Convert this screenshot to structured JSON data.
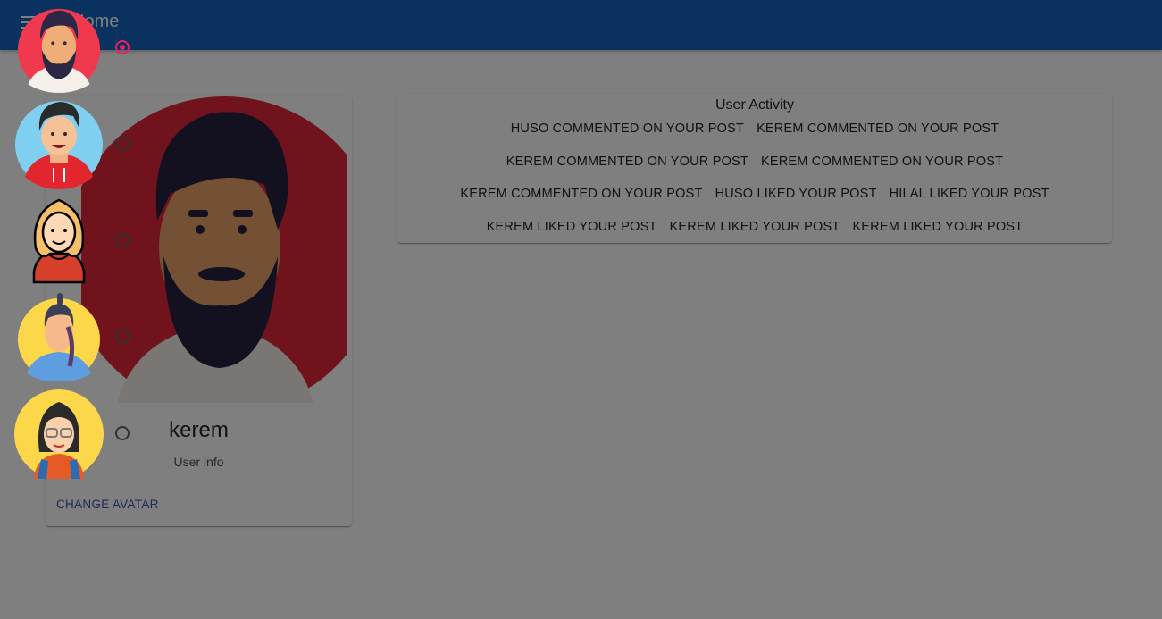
{
  "appbar": {
    "title": "Home",
    "color": "#1565c0"
  },
  "profile": {
    "username": "kerem",
    "subtitle": "User info",
    "change_avatar_label": "CHANGE AVATAR"
  },
  "activity": {
    "title": "User Activity",
    "rows": [
      [
        "HUSO COMMENTED ON YOUR POST",
        "KEREM COMMENTED ON YOUR POST"
      ],
      [
        "KEREM COMMENTED ON YOUR POST",
        "KEREM COMMENTED ON YOUR POST"
      ],
      [
        "KEREM COMMENTED ON YOUR POST",
        "HUSO LIKED YOUR POST",
        "HILAL LIKED YOUR POST"
      ],
      [
        "KEREM LIKED YOUR POST",
        "KEREM LIKED YOUR POST",
        "KEREM LIKED YOUR POST"
      ]
    ]
  },
  "avatar_options": [
    {
      "icon": "bearded-man-avatar-icon",
      "selected": true
    },
    {
      "icon": "man-red-hoodie-avatar-icon",
      "selected": false
    },
    {
      "icon": "woman-blonde-avatar-icon",
      "selected": false
    },
    {
      "icon": "woman-ponytail-avatar-icon",
      "selected": false
    },
    {
      "icon": "woman-glasses-avatar-icon",
      "selected": false
    }
  ]
}
